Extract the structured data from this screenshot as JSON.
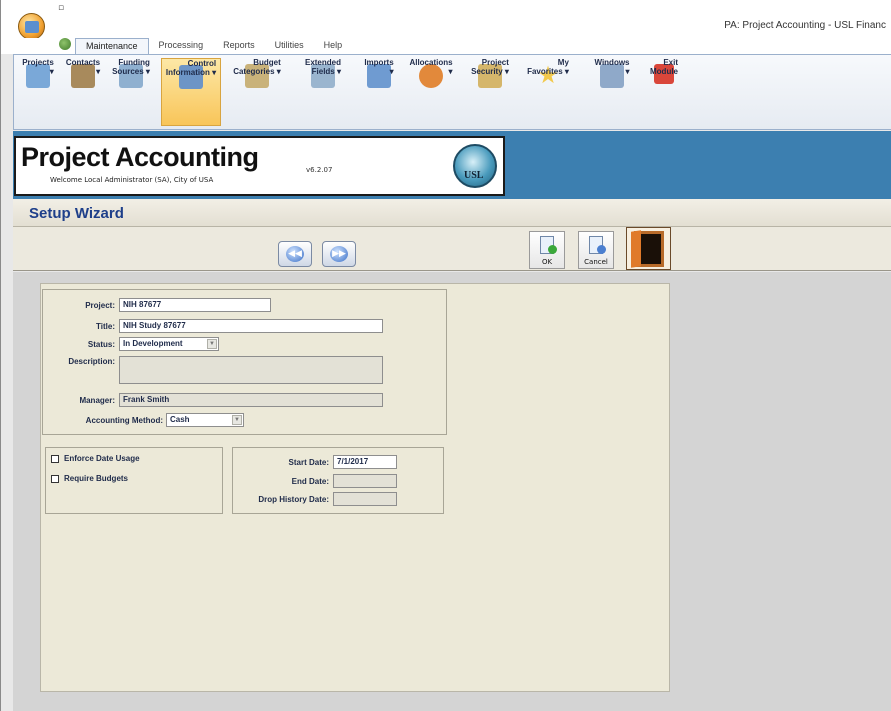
{
  "window": {
    "title": "PA: Project Accounting - USL Financ",
    "qa_dot": "▫"
  },
  "tabs": [
    {
      "label": "Maintenance",
      "active": true
    },
    {
      "label": "Processing",
      "active": false
    },
    {
      "label": "Reports",
      "active": false
    },
    {
      "label": "Utilities",
      "active": false
    },
    {
      "label": "Help",
      "active": false
    }
  ],
  "ribbon": {
    "buttons": [
      {
        "label": "Projects\n▾",
        "icon": "projects-icon",
        "color": "#7aa8d8"
      },
      {
        "label": "Contacts\n▾",
        "icon": "contacts-icon",
        "color": "#a88a5c"
      },
      {
        "label": "Funding\nSources ▾",
        "icon": "funding-sources-icon",
        "color": "#8fb0d0"
      },
      {
        "label": "Control\nInformation ▾",
        "icon": "control-information-icon",
        "color": "#6d95c6"
      },
      {
        "label": "Budget\nCategories ▾",
        "icon": "budget-categories-icon",
        "color": "#c9b27a"
      },
      {
        "label": "Extended\nFields ▾",
        "icon": "extended-fields-icon",
        "color": "#9ab5cf"
      },
      {
        "label": "Imports\n▾",
        "icon": "imports-icon",
        "color": "#6f9bd1"
      },
      {
        "label": "Allocations\n▾",
        "icon": "allocations-icon",
        "color": "#e2893b"
      },
      {
        "label": "Project\nSecurity ▾",
        "icon": "project-security-icon",
        "color": "#d5b66b"
      },
      {
        "label": "My\nFavorites ▾",
        "icon": "favorites-star-icon",
        "color": "#f2c94c"
      },
      {
        "label": "Windows\n▾",
        "icon": "windows-icon",
        "color": "#8fa9c9"
      },
      {
        "label": "Exit\nModule",
        "icon": "exit-module-icon",
        "color": "#d9463a"
      }
    ]
  },
  "brand": {
    "title": "Project Accounting",
    "version": "v6.2.07",
    "welcome": "Welcome Local Administrator (SA), City of USA",
    "logo_text": "USL"
  },
  "wizard": {
    "title": "Setup Wizard"
  },
  "toolbar": {
    "prev_icon": "◀◀",
    "next_icon": "▶▶",
    "ok_label": "OK",
    "cancel_label": "Cancel"
  },
  "form": {
    "project_label": "Project:",
    "project_value": "NIH 87677",
    "title_label": "Title:",
    "title_value": "NIH Study 87677",
    "status_label": "Status:",
    "status_value": "In Development",
    "description_label": "Description:",
    "description_value": "",
    "manager_label": "Manager:",
    "manager_value": "Frank Smith",
    "accounting_method_label": "Accounting Method:",
    "accounting_method_value": "Cash",
    "enforce_date_usage_label": "Enforce Date Usage",
    "require_budgets_label": "Require Budgets",
    "start_date_label": "Start Date:",
    "start_date_value": "7/1/2017",
    "end_date_label": "End Date:",
    "end_date_value": "",
    "drop_history_date_label": "Drop History Date:",
    "drop_history_date_value": ""
  },
  "colors": {
    "header_band": "#3c7fb0",
    "wizard_title": "#1e3f8a",
    "form_background": "#ece9d8"
  }
}
